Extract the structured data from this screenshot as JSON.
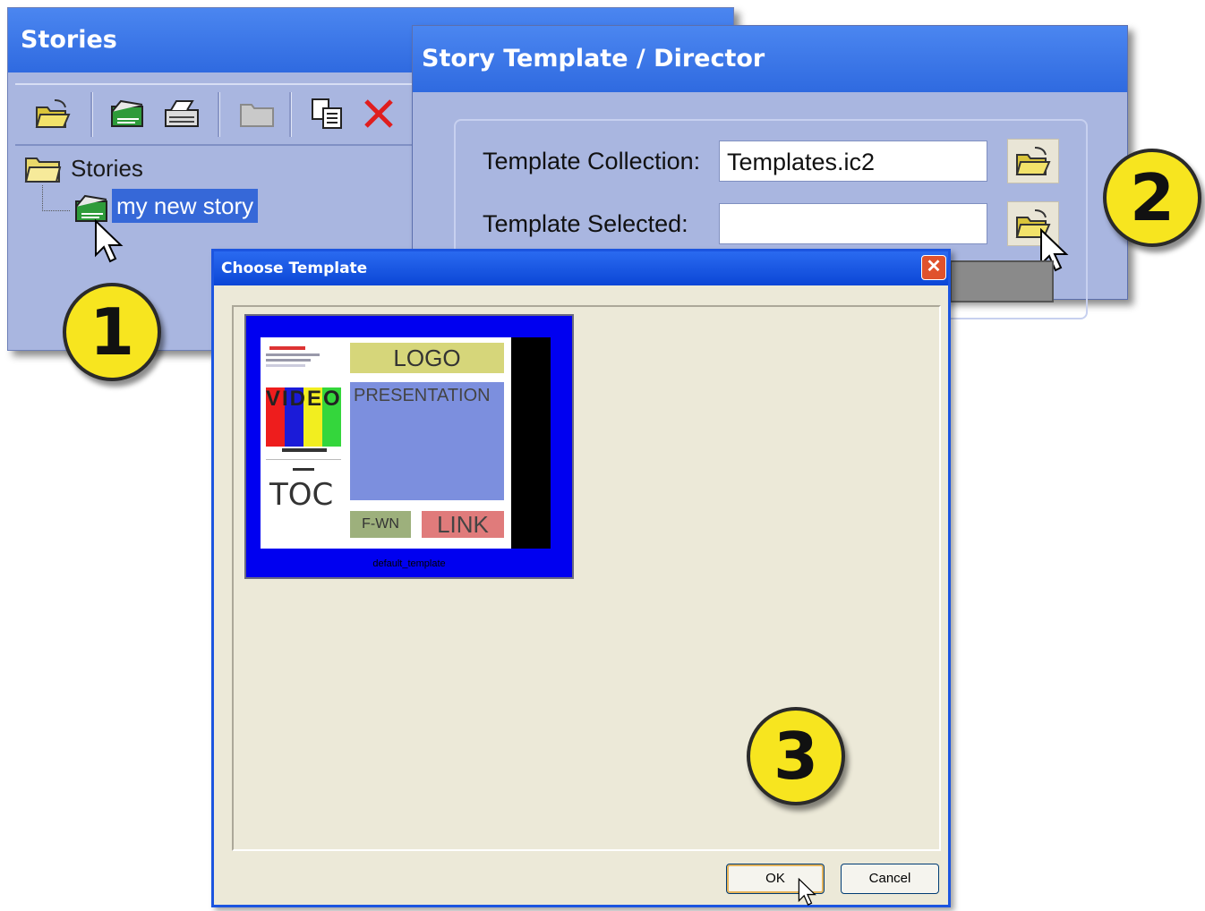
{
  "stories_panel": {
    "title": "Stories",
    "toolbar_icons": [
      "open-folder-icon",
      "new-story-icon",
      "print-icon",
      "folder-icon",
      "copy-icon",
      "delete-icon"
    ],
    "tree": {
      "root_label": "Stories",
      "child_label": "my new story"
    }
  },
  "director_panel": {
    "title": "Story Template / Director",
    "collection_label": "Template Collection:",
    "collection_value": "Templates.ic2",
    "selected_label": "Template Selected:",
    "selected_value": ""
  },
  "dialog": {
    "title": "Choose Template",
    "template": {
      "logo": "LOGO",
      "video": "VIDEO",
      "presentation": "PRESENTATION",
      "toc": "TOC",
      "frame": "F-WN",
      "link": "LINK",
      "name": "default_template"
    },
    "ok_label": "OK",
    "cancel_label": "Cancel"
  },
  "badges": {
    "one": "1",
    "two": "2",
    "three": "3"
  },
  "colors": {
    "title_bar": "#3a78ec",
    "panel_bg": "#a9b6e0",
    "dialog_bg": "#ece9d8",
    "badge": "#f7e51f",
    "selection": "#3668d8"
  }
}
